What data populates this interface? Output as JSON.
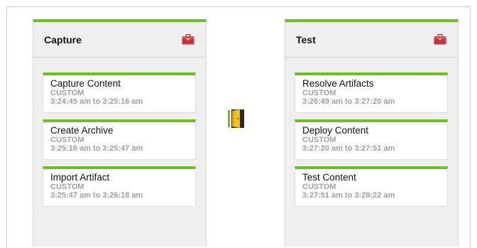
{
  "stages": [
    {
      "title": "Capture",
      "jobs": [
        {
          "name": "Capture Content",
          "type": "CUSTOM",
          "time": "3:24:45 am to 3:25:16 am"
        },
        {
          "name": "Create Archive",
          "type": "CUSTOM",
          "time": "3:25:16 am to 3:25:47 am"
        },
        {
          "name": "Import Artifact",
          "type": "CUSTOM",
          "time": "3:25:47 am to 3:26:18 am"
        }
      ]
    },
    {
      "title": "Test",
      "jobs": [
        {
          "name": "Resolve Artifacts",
          "type": "CUSTOM",
          "time": "3:26:49 am to 3:27:20 am"
        },
        {
          "name": "Deploy Content",
          "type": "CUSTOM",
          "time": "3:27:20 am to 3:27:51 am"
        },
        {
          "name": "Test Content",
          "type": "CUSTOM",
          "time": "3:27:51 am to 3:28:22 am"
        }
      ]
    }
  ],
  "colors": {
    "accent": "#6cc01f",
    "toolbox": "#c6343a",
    "gate": "#f2c500"
  },
  "icons": {
    "stage_tool": "toolbox-icon",
    "gate": "gate-door-icon"
  }
}
